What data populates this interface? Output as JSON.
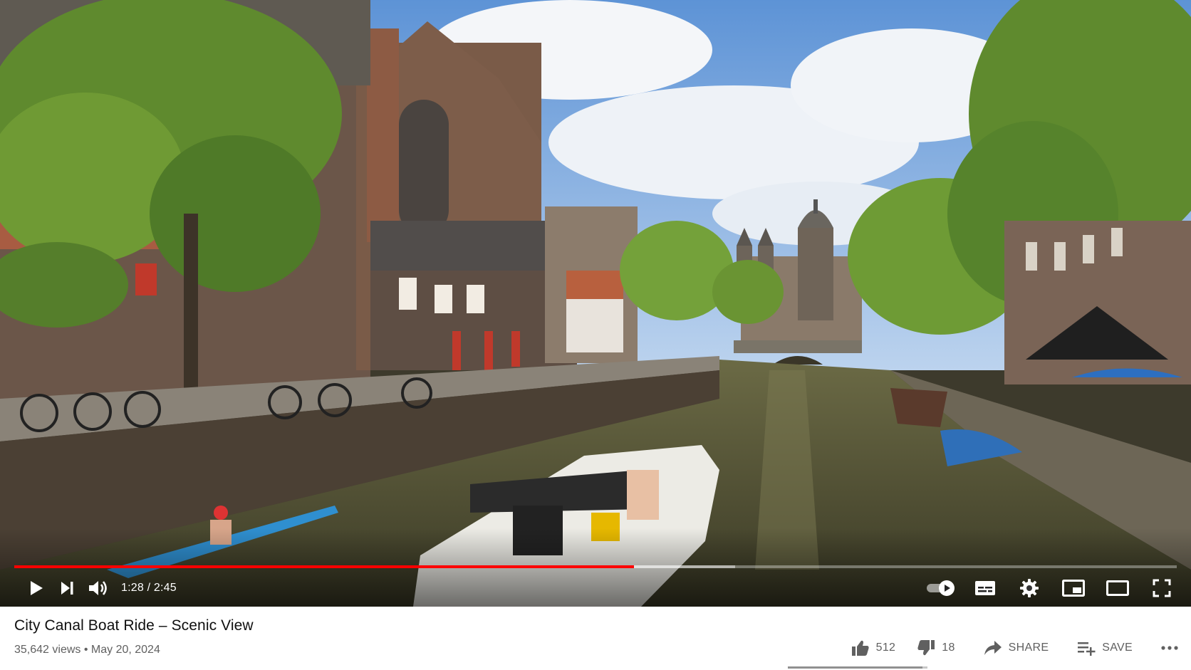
{
  "player": {
    "progress_fraction": 0.533,
    "time_current": "1:28",
    "time_separator": " / ",
    "time_total": "2:45",
    "accent_color": "#ff0000"
  },
  "controls": {
    "play_icon": "play-icon",
    "next_icon": "next-icon",
    "volume_icon": "volume-icon",
    "autoplay_icon": "autoplay-toggle-icon",
    "captions_icon": "captions-icon",
    "settings_icon": "gear-icon",
    "miniplayer_icon": "miniplayer-icon",
    "theater_icon": "theater-icon",
    "fullscreen_icon": "fullscreen-icon"
  },
  "video": {
    "title": "City Canal Boat Ride – Scenic View",
    "views": "35,642 views",
    "separator": " • ",
    "date": "May 20, 2024"
  },
  "actions": {
    "likes": "512",
    "dislikes": "18",
    "share_label": "SHARE",
    "save_label": "SAVE",
    "like_fraction": 0.966
  }
}
